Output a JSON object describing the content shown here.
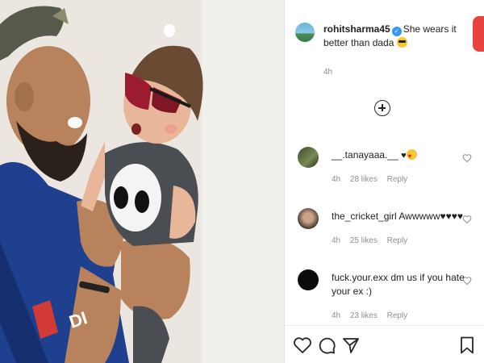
{
  "caption": {
    "username": "rohitsharma45",
    "text": "She wears it better than dada",
    "time": "4h"
  },
  "comments": [
    {
      "username": "__.tanayaaa.__",
      "text": "",
      "time": "4h",
      "likes": "28 likes",
      "reply": "Reply"
    },
    {
      "username": "the_cricket_girl",
      "text": "Awwwww♥♥♥♥",
      "time": "4h",
      "likes": "25 likes",
      "reply": "Reply"
    },
    {
      "username": "fuck.your.exx",
      "text": "dm us if you hate your ex :)",
      "time": "4h",
      "likes": "23 likes",
      "reply": "Reply"
    }
  ],
  "jersey_text": "DI",
  "colors": {
    "verified": "#3897f0",
    "meta": "#8e8e8e",
    "text": "#222222",
    "edge_accent": "#e8433f"
  },
  "icons": [
    "verified-badge-icon",
    "plus-circle-icon",
    "heart-icon",
    "comment-icon",
    "share-icon",
    "bookmark-icon"
  ]
}
